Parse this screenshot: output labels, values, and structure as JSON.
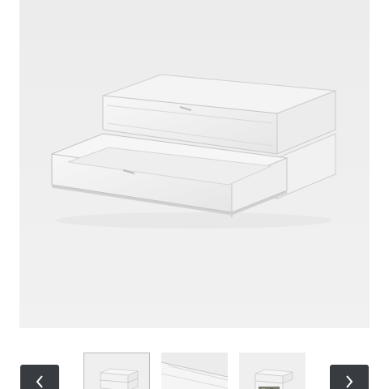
{
  "gallery": {
    "main_image": {
      "icon": "acrylic-two-drawer-box-image"
    },
    "prev_button": {
      "icon": "chevron-left-icon",
      "color": "#383b40"
    },
    "next_button": {
      "icon": "chevron-right-icon",
      "color": "#383b40"
    },
    "thumbnails": [
      {
        "icon": "acrylic-box-front-thumbnail",
        "selected": true
      },
      {
        "icon": "acrylic-box-closeup-thumbnail",
        "selected": false
      },
      {
        "icon": "acrylic-box-with-contents-thumbnail",
        "selected": false
      }
    ]
  }
}
